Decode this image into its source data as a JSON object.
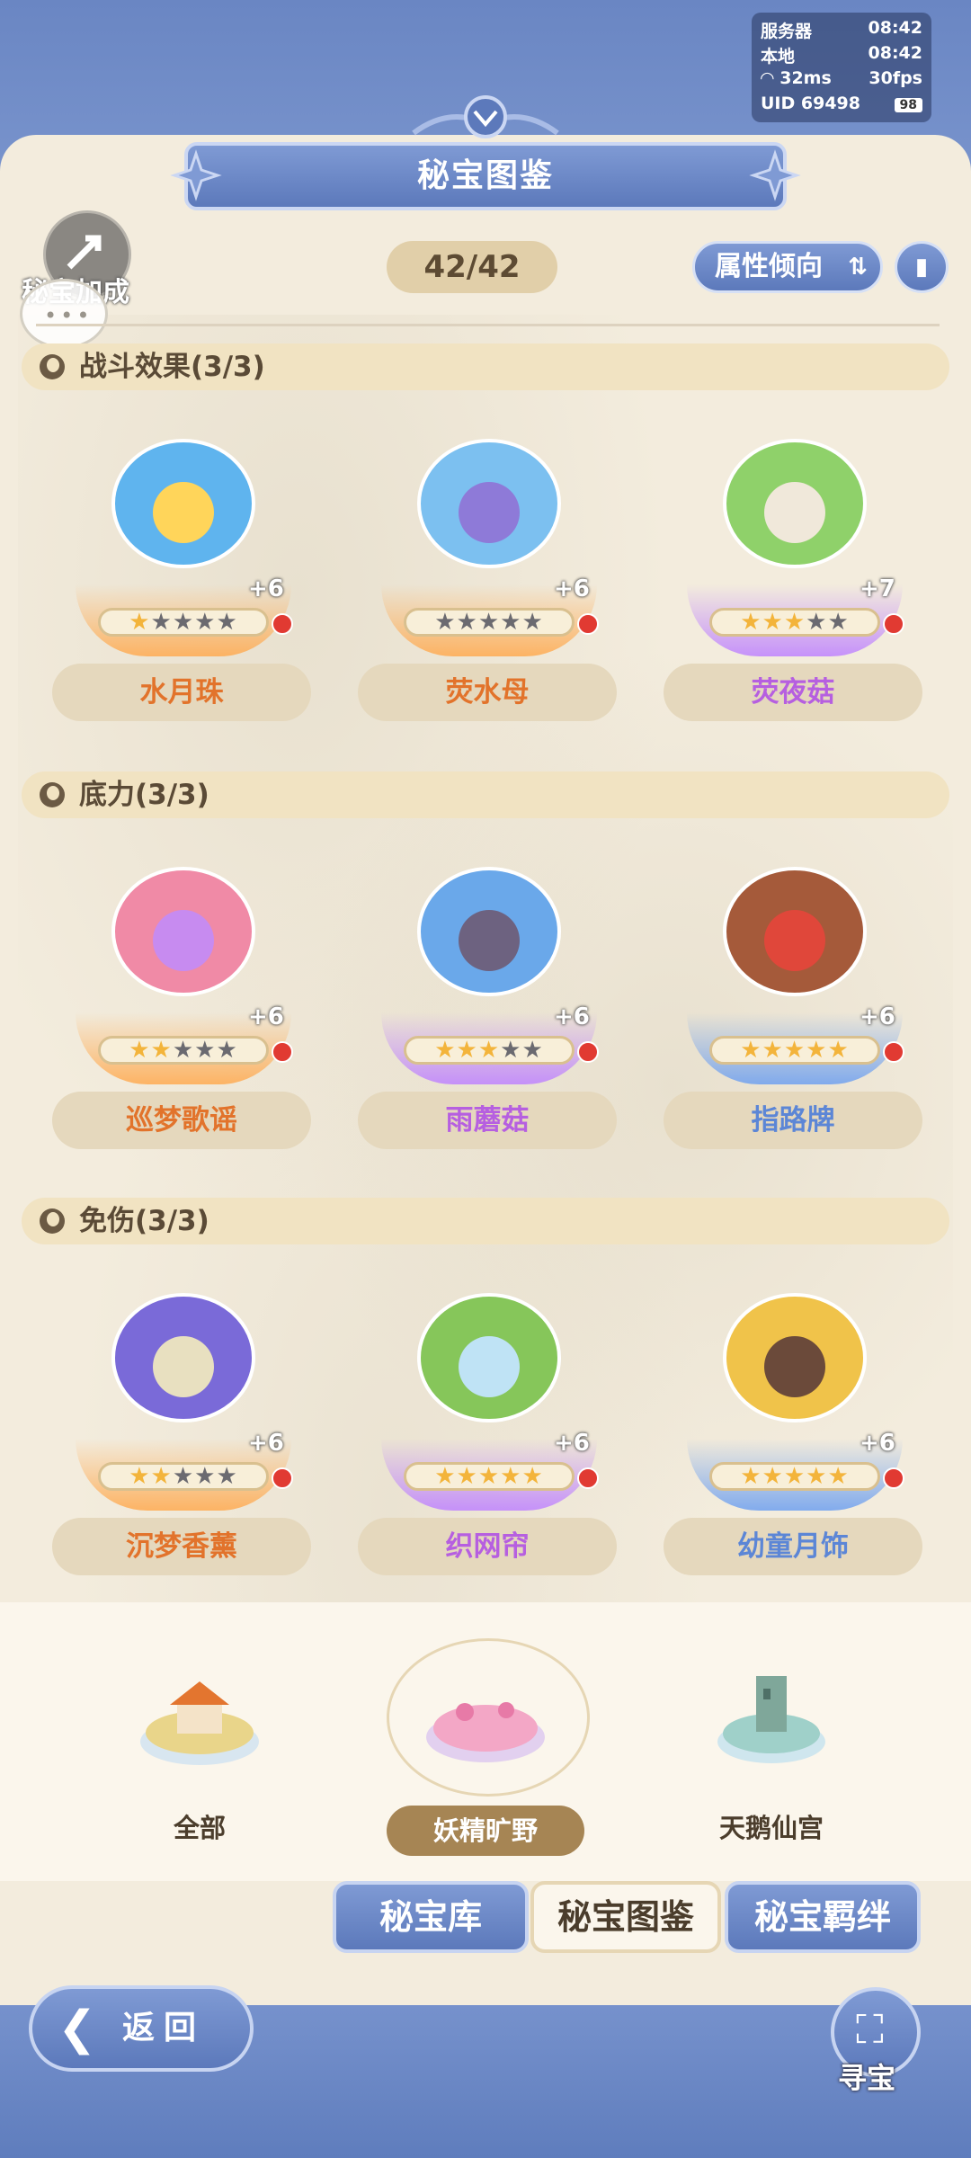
{
  "status": {
    "server_label": "服务器",
    "server_time": "08:42",
    "local_label": "本地",
    "local_time": "08:42",
    "ping": "32ms",
    "fps": "30fps",
    "uid": "UID 69498",
    "battery": "98"
  },
  "header": {
    "title": "秘宝图鉴"
  },
  "toolbar": {
    "bonus_label": "秘宝加成",
    "counter": "42/42",
    "attribute_button": "属性倾向",
    "swap_icon": "⇅"
  },
  "categories": [
    {
      "title": "战斗效果(3/3)",
      "items": [
        {
          "name": "水月珠",
          "level": "+6",
          "stars": 1,
          "max_stars": 5,
          "rarity": "orange"
        },
        {
          "name": "荧水母",
          "level": "+6",
          "stars": 0,
          "max_stars": 5,
          "rarity": "orange"
        },
        {
          "name": "荧夜菇",
          "level": "+7",
          "stars": 3,
          "max_stars": 5,
          "rarity": "purple"
        }
      ]
    },
    {
      "title": "底力(3/3)",
      "items": [
        {
          "name": "巡梦歌谣",
          "level": "+6",
          "stars": 2,
          "max_stars": 5,
          "rarity": "orange"
        },
        {
          "name": "雨蘑菇",
          "level": "+6",
          "stars": 3,
          "max_stars": 5,
          "rarity": "purple"
        },
        {
          "name": "指路牌",
          "level": "+6",
          "stars": 5,
          "max_stars": 5,
          "rarity": "blue"
        }
      ]
    },
    {
      "title": "免伤(3/3)",
      "items": [
        {
          "name": "沉梦香薰",
          "level": "+6",
          "stars": 2,
          "max_stars": 5,
          "rarity": "orange"
        },
        {
          "name": "织网帘",
          "level": "+6",
          "stars": 5,
          "max_stars": 5,
          "rarity": "purple"
        },
        {
          "name": "幼童月饰",
          "level": "+6",
          "stars": 5,
          "max_stars": 5,
          "rarity": "blue"
        }
      ]
    }
  ],
  "regions": [
    {
      "label": "全部",
      "selected": false
    },
    {
      "label": "妖精旷野",
      "selected": true
    },
    {
      "label": "天鹅仙宫",
      "selected": false
    }
  ],
  "tabs": [
    {
      "label": "秘宝库",
      "active": false
    },
    {
      "label": "秘宝图鉴",
      "active": true
    },
    {
      "label": "秘宝羁绊",
      "active": false
    }
  ],
  "footer": {
    "back_label": "返回",
    "treasure_label": "寻宝"
  },
  "colors": {
    "accent_blue": "#6b88c4",
    "panel": "#f3ecdd",
    "orange_name": "#e2732b",
    "purple_name": "#b65fe0",
    "blue_name": "#5c86d6",
    "badge_red": "#e13a32"
  }
}
